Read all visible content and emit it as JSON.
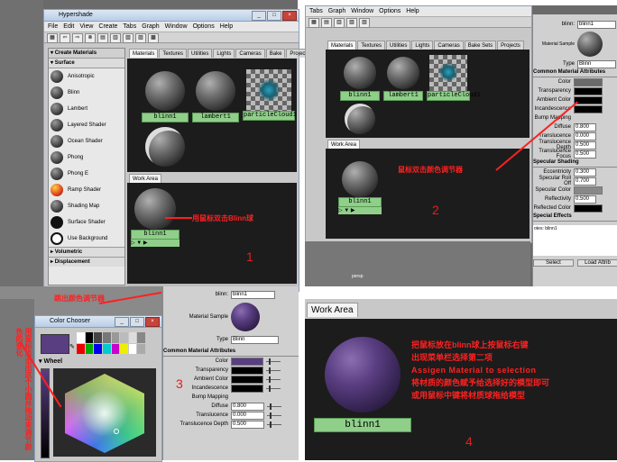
{
  "panel1": {
    "window_title": "Hypershade",
    "menu": [
      "File",
      "Edit",
      "View",
      "Create",
      "Tabs",
      "Graph",
      "Window",
      "Options",
      "Help"
    ],
    "create_header": "Create Materials",
    "surface_header": "Surface",
    "materials": [
      "Anisotropic",
      "Blinn",
      "Lambert",
      "Layered Shader",
      "Ocean Shader",
      "Phong",
      "Phong E",
      "Ramp Shader",
      "Shading Map",
      "Surface Shader",
      "Use Background"
    ],
    "volumetric": "Volumetric",
    "displacement": "Displacement",
    "tabs": [
      "Materials",
      "Textures",
      "Utilities",
      "Lights",
      "Cameras",
      "Bake Sets",
      "Projects"
    ],
    "swatches": [
      "blinn1",
      "lambert1",
      "particleCloud1"
    ],
    "work_area_tab": "Work Area",
    "work_swatch": "blinn1",
    "annotation": "用鼠标双击Blinn球",
    "step": "1"
  },
  "panel2": {
    "menu": [
      "Tabs",
      "Graph",
      "Window",
      "Options",
      "Help"
    ],
    "tabs": [
      "Materials",
      "Textures",
      "Utilities",
      "Lights",
      "Cameras",
      "Bake Sets",
      "Projects"
    ],
    "swatches": [
      "blinn1",
      "lambert1",
      "particleCloud1"
    ],
    "work_area_tab": "Work Area",
    "work_swatch": "blinn1",
    "annotation": "鼠标双击颜色调节器",
    "step": "2",
    "attr": {
      "name_label": "blinn:",
      "name_value": "blinn1",
      "sample_label": "Material Sample",
      "type_label": "Type",
      "type_value": "Blinn",
      "common_header": "Common Material Attributes",
      "rows": [
        {
          "label": "Color",
          "value": ""
        },
        {
          "label": "Transparency",
          "value": ""
        },
        {
          "label": "Ambient Color",
          "value": ""
        },
        {
          "label": "Incandescence",
          "value": ""
        },
        {
          "label": "Bump Mapping",
          "value": ""
        },
        {
          "label": "Diffuse",
          "value": "0.800"
        },
        {
          "label": "Translucence",
          "value": "0.000"
        },
        {
          "label": "Translucence Depth",
          "value": "0.500"
        },
        {
          "label": "Translucence Focus",
          "value": "0.500"
        }
      ],
      "specular_header": "Specular Shading",
      "spec_rows": [
        {
          "label": "Eccentricity",
          "value": "0.300"
        },
        {
          "label": "Specular Roll Off",
          "value": "0.700"
        },
        {
          "label": "Specular Color",
          "value": ""
        },
        {
          "label": "Reflectivity",
          "value": "0.500"
        },
        {
          "label": "Reflected Color",
          "value": ""
        }
      ],
      "special_header": "Special Effects",
      "notes": "otes: blinn1",
      "select_btn": "Select",
      "load_btn": "Load Attrib"
    },
    "viewport_label": "persp"
  },
  "panel3": {
    "annotation_top": "跳出颜色调节器",
    "chooser_title": "Color Chooser",
    "wheel_label": "Wheel",
    "vertical_note": "用鼠标点击出这个小圆并拖动来调节颜色的变化",
    "step": "3",
    "attr": {
      "name_label": "blinn:",
      "name_value": "blinn1",
      "sample_label": "Material Sample",
      "type_label": "Type",
      "type_value": "Blinn",
      "common_header": "Common Material Attributes",
      "rows": [
        {
          "label": "Color",
          "value": ""
        },
        {
          "label": "Transparency",
          "value": ""
        },
        {
          "label": "Ambient Color",
          "value": ""
        },
        {
          "label": "Incandescence",
          "value": ""
        },
        {
          "label": "Bump Mapping",
          "value": ""
        },
        {
          "label": "Diffuse",
          "value": "0.800"
        },
        {
          "label": "Translucence",
          "value": "0.000"
        },
        {
          "label": "Translucence Depth",
          "value": "0.500"
        }
      ]
    }
  },
  "panel4": {
    "work_area_tab": "Work Area",
    "swatch": "blinn1",
    "annotation_lines": [
      "把鼠标放在blinn球上按鼠标右键",
      "出现菜单栏选择第二项",
      "Assigen Material to selection",
      "将材质的颜色赋予给选择好的模型即可",
      "或用鼠标中键将材质球拖给模型"
    ],
    "step": "4"
  },
  "colors": {
    "annotation": "#ff2020",
    "swatch_label_bg": "#8fcf8a",
    "material_purple": "#5a3e82"
  }
}
